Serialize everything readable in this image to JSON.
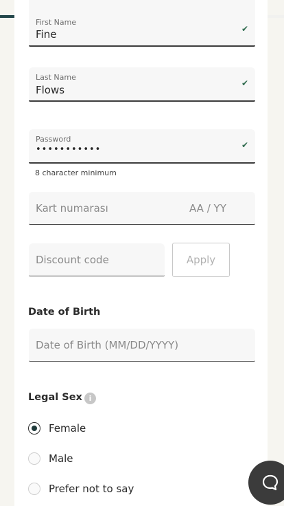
{
  "progress": {
    "fraction": 0.53,
    "fill_color": "#24474a"
  },
  "fields": {
    "first_name": {
      "label": "First Name",
      "value": "Fine"
    },
    "last_name": {
      "label": "Last Name",
      "value": "Flows"
    },
    "password": {
      "label": "Password",
      "value": "•••••••••••",
      "hint": "8 character minimum"
    },
    "card": {
      "number_placeholder": "Kart numarası",
      "expiry_placeholder": "AA / YY"
    },
    "discount": {
      "placeholder": "Discount code",
      "apply_label": "Apply"
    }
  },
  "date_of_birth": {
    "title": "Date of Birth",
    "placeholder": "Date of Birth (MM/DD/YYYY)"
  },
  "legal_sex": {
    "title": "Legal Sex",
    "info_icon": "info-icon",
    "options": [
      {
        "label": "Female",
        "selected": true
      },
      {
        "label": "Male",
        "selected": false
      },
      {
        "label": "Prefer not to say",
        "selected": false
      }
    ]
  },
  "chat": {
    "icon": "chat-bubble-icon",
    "color": "#3b3b3b"
  },
  "colors": {
    "accent": "#24474a",
    "check": "#2f6b4e",
    "background": "#f6f5f0"
  }
}
